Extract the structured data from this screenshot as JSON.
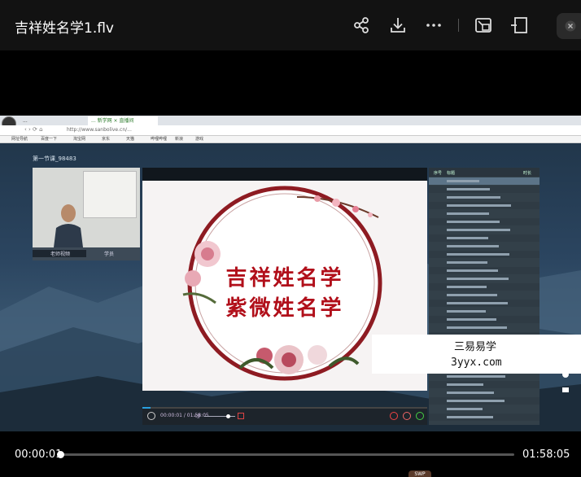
{
  "window": {
    "title": "吉祥姓名学1.flv",
    "toolbar": {
      "share_icon": "share-icon",
      "download_icon": "download-icon",
      "more_icon": "more-icon",
      "pip_icon": "picture-in-picture-icon",
      "window_icon": "window-mode-icon",
      "close_icon": "close-icon"
    }
  },
  "video": {
    "browser": {
      "tabs": [
        "...",
        "...  新学网 × 直播间"
      ],
      "url": "http://www.sanbolive.cn/...",
      "bookmarks": [
        "网址导航",
        "百度一下",
        "淘宝网",
        "京东",
        "天猫",
        "哔哩哔哩",
        "新浪",
        "游戏"
      ]
    },
    "room_title": "第一节课_98483",
    "cam_tabs": [
      "老师视频",
      "学员"
    ],
    "slide": {
      "line1": "吉祥姓名学",
      "line2": "紫微姓名学"
    },
    "playlist": {
      "headers": [
        "序号",
        "标题",
        "时长"
      ],
      "rows_count": 30,
      "selected_row": 1
    },
    "watermark": {
      "line1": "三易易学",
      "line2": "3yyx.com"
    }
  },
  "player": {
    "current_time": "00:00:01",
    "total_time": "01:58:05",
    "progress_fraction": 0.0,
    "badge": "SWP"
  }
}
